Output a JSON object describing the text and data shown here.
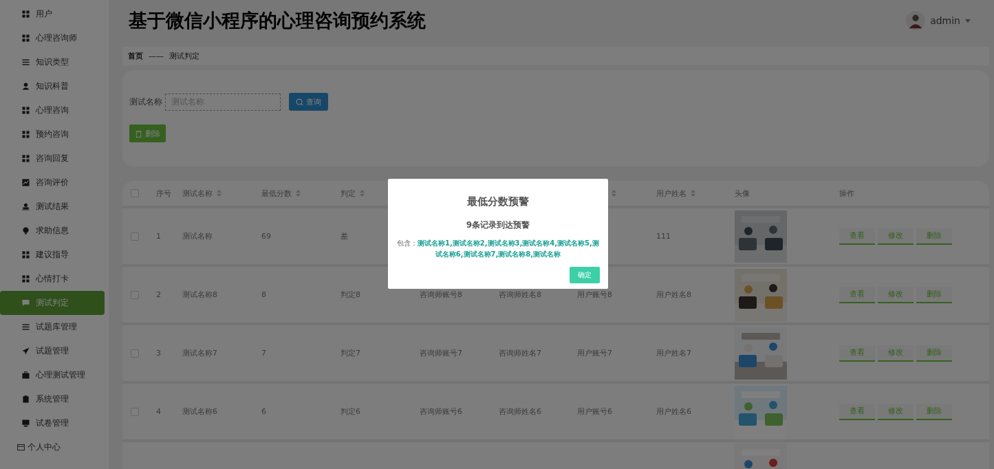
{
  "header": {
    "title": "基于微信小程序的心理咨询预约系统",
    "user": "admin"
  },
  "sidebar": {
    "items": [
      {
        "label": "用户",
        "selected": false
      },
      {
        "label": "心理咨询师",
        "selected": false
      },
      {
        "label": "知识类型",
        "selected": false
      },
      {
        "label": "知识科普",
        "selected": false
      },
      {
        "label": "心理咨询",
        "selected": false
      },
      {
        "label": "预约咨询",
        "selected": false
      },
      {
        "label": "咨询回复",
        "selected": false
      },
      {
        "label": "咨询评价",
        "selected": false
      },
      {
        "label": "测试结果",
        "selected": false
      },
      {
        "label": "求助信息",
        "selected": false
      },
      {
        "label": "建议指导",
        "selected": false
      },
      {
        "label": "心情打卡",
        "selected": false
      },
      {
        "label": "测试判定",
        "selected": true
      },
      {
        "label": "试题库管理",
        "selected": false
      },
      {
        "label": "试题管理",
        "selected": false
      },
      {
        "label": "心理测试管理",
        "selected": false
      },
      {
        "label": "系统管理",
        "selected": false
      },
      {
        "label": "试卷管理",
        "selected": false
      }
    ],
    "personal_center": "个人中心"
  },
  "breadcrumb": {
    "home": "首页",
    "separator": "——",
    "current": "测试判定"
  },
  "search": {
    "label": "测试名称",
    "placeholder": "测试名称",
    "query_button": "查询",
    "delete_button": "删除"
  },
  "table": {
    "header_checked": false,
    "columns": [
      {
        "kind": "text",
        "label": "序号",
        "sortable": false
      },
      {
        "kind": "text",
        "label": "测试名称",
        "sortable": true
      },
      {
        "kind": "text",
        "label": "最低分数",
        "sortable": true
      },
      {
        "kind": "text",
        "label": "判定",
        "sortable": true
      },
      {
        "kind": "text"
      },
      {
        "kind": "text"
      },
      {
        "kind": "text",
        "sortable": true
      },
      {
        "kind": "text",
        "label": "用户姓名",
        "sortable": true
      },
      {
        "kind": "picture",
        "label": "头像",
        "sortable": false
      },
      {
        "kind": "actions",
        "label": "操作",
        "sortable": false
      }
    ],
    "rows": [
      {
        "kind": "full",
        "checked": false,
        "cells": [
          "1",
          "测试名称",
          "69",
          "差",
          null,
          null,
          null,
          "111"
        ],
        "actions": [
          "查看",
          "修改",
          "删除"
        ]
      },
      {
        "kind": "full",
        "checked": false,
        "cells": [
          "2",
          "测试名称8",
          "8",
          "判定8",
          "咨询师账号8",
          "咨询师姓名8",
          "用户账号8",
          "用户姓名8"
        ],
        "actions": [
          "查看",
          "修改",
          "删除"
        ]
      },
      {
        "kind": "full",
        "checked": false,
        "cells": [
          "3",
          "测试名称7",
          "7",
          "判定7",
          "咨询师账号7",
          "咨询师姓名7",
          "用户账号7",
          "用户姓名7"
        ],
        "actions": [
          "查看",
          "修改",
          "删除"
        ]
      },
      {
        "kind": "full",
        "checked": false,
        "cells": [
          "4",
          "测试名称6",
          "6",
          "判定6",
          "咨询师账号6",
          "咨询师姓名6",
          "用户账号6",
          "用户姓名6"
        ],
        "actions": [
          "查看",
          "修改",
          "删除"
        ]
      },
      {
        "kind": "partial"
      }
    ]
  },
  "dialog": {
    "title": "最低分数预警",
    "subtitle": "9条记录到达预警",
    "prefix": "包含：",
    "names": "测试名称1,测试名称2,测试名称3,测试名称4,测试名称5,测试名称6,测试名称7,测试名称8,测试名称",
    "confirm": "确定"
  }
}
